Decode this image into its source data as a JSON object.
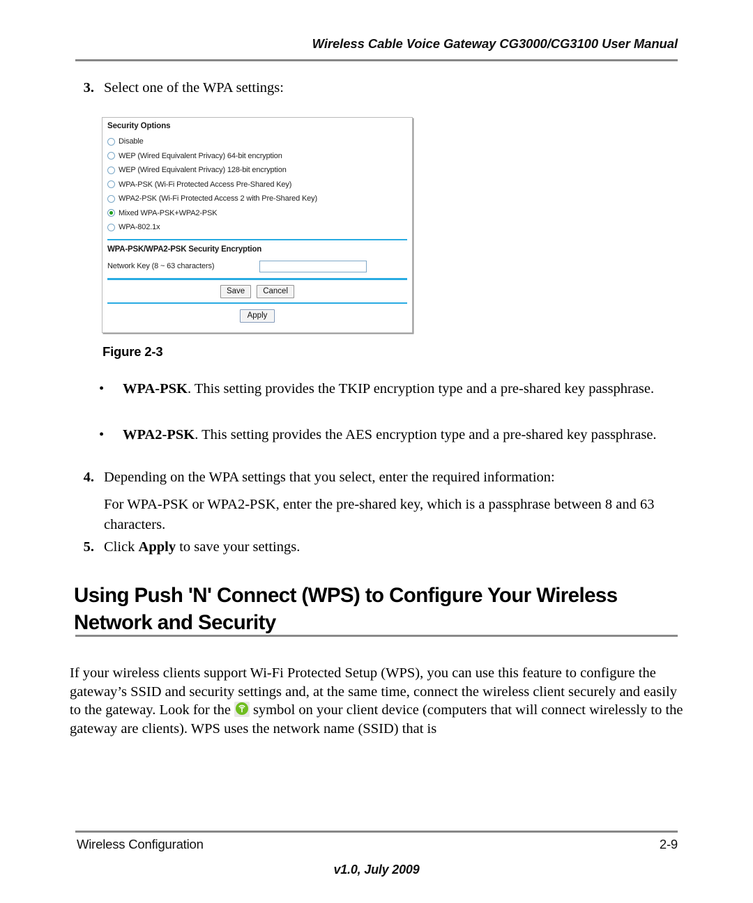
{
  "header": {
    "running_title": "Wireless Cable Voice Gateway CG3000/CG3100 User Manual"
  },
  "steps": {
    "step3": {
      "number": "3.",
      "text": "Select one of the WPA settings:"
    },
    "step4": {
      "number": "4.",
      "text": "Depending on the WPA settings that you select, enter the required information:"
    },
    "step4_sub": "For WPA-PSK or WPA2-PSK, enter the pre-shared key, which is a passphrase between 8 and 63 characters.",
    "step5": {
      "number": "5.",
      "prefix": "Click ",
      "bold": "Apply",
      "suffix": " to save your settings."
    }
  },
  "ui_screenshot": {
    "security_options_title": "Security Options",
    "options": [
      {
        "label": "Disable",
        "selected": false
      },
      {
        "label": "WEP (Wired Equivalent Privacy) 64-bit encryption",
        "selected": false
      },
      {
        "label": "WEP (Wired Equivalent Privacy) 128-bit encryption",
        "selected": false
      },
      {
        "label": "WPA-PSK (Wi-Fi Protected Access Pre-Shared Key)",
        "selected": false
      },
      {
        "label": "WPA2-PSK (Wi-Fi Protected Access 2 with Pre-Shared Key)",
        "selected": false
      },
      {
        "label": "Mixed WPA-PSK+WPA2-PSK",
        "selected": true
      },
      {
        "label": "WPA-802.1x",
        "selected": false
      }
    ],
    "encryption_title": "WPA-PSK/WPA2-PSK Security Encryption",
    "network_key_label": "Network Key (8 ~ 63 characters)",
    "network_key_value": "",
    "network_key_placeholder": "",
    "save_label": "Save",
    "cancel_label": "Cancel",
    "apply_label": "Apply",
    "colors": {
      "divider": "#29abe2",
      "radio_selected_dot": "#21a021",
      "input_border": "#7fa8c8"
    }
  },
  "figure": {
    "caption": "Figure 2-3"
  },
  "bullets": [
    {
      "bullet": "•",
      "bold": "WPA-PSK",
      "text": ". This setting provides the TKIP encryption type and a pre-shared key passphrase."
    },
    {
      "bullet": "•",
      "bold": "WPA2-PSK",
      "text": ". This setting provides the AES encryption type and a pre-shared key passphrase."
    }
  ],
  "section": {
    "heading": "Using Push 'N' Connect (WPS) to Configure Your Wireless Network and Security",
    "paragraph_part1": "If your wireless clients support Wi-Fi Protected Setup (WPS), you can use this feature to configure the gateway’s SSID and security settings and, at the same time, connect the wireless client securely and easily to the gateway. Look for the",
    "paragraph_part2": "symbol on your client device (computers that will connect wirelessly to the gateway are clients). WPS uses the network name (SSID) that is",
    "inline_icon_name": "wps-symbol-icon",
    "inline_icon_color": "#6fbd1f"
  },
  "footer": {
    "left": "Wireless Configuration",
    "right": "2-9",
    "version": "v1.0, July 2009"
  }
}
